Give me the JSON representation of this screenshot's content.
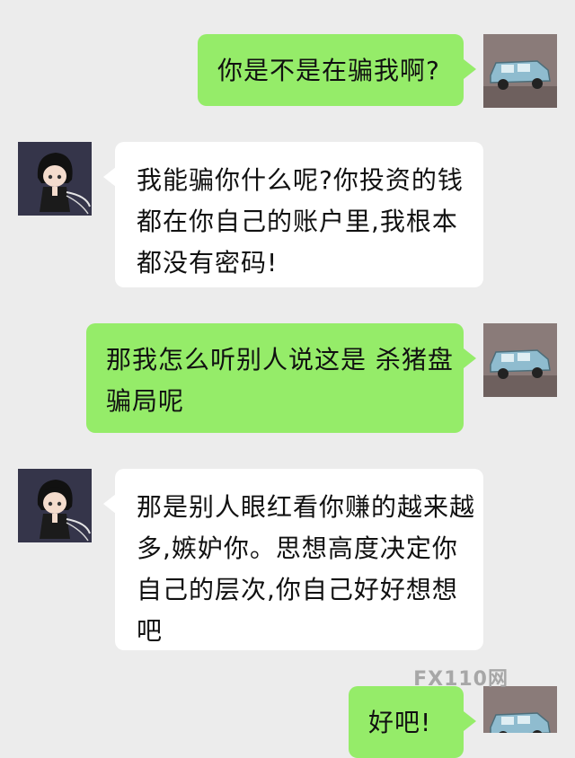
{
  "colors": {
    "background": "#ececec",
    "outgoing_bubble": "#95ec69",
    "incoming_bubble": "#ffffff"
  },
  "messages": [
    {
      "side": "right",
      "avatar": "car-avatar-icon",
      "lines": [
        "你是不是在骗我啊?"
      ]
    },
    {
      "side": "left",
      "avatar": "anime-avatar-icon",
      "lines": [
        "我能骗你什么呢?你投资的钱",
        "都在你自己的账户里,我根本",
        "都没有密码!"
      ]
    },
    {
      "side": "right",
      "avatar": "car-avatar-icon",
      "lines": [
        "那我怎么听别人说这是 杀猪盘",
        "骗局呢"
      ]
    },
    {
      "side": "left",
      "avatar": "anime-avatar-icon",
      "lines": [
        "那是别人眼红看你赚的越来越",
        "多,嫉妒你。思想高度决定你",
        "自己的层次,你自己好好想想",
        "吧"
      ]
    },
    {
      "side": "right",
      "avatar": "car-avatar-icon",
      "lines": [
        "好吧!"
      ]
    }
  ],
  "watermark": "FX110网"
}
